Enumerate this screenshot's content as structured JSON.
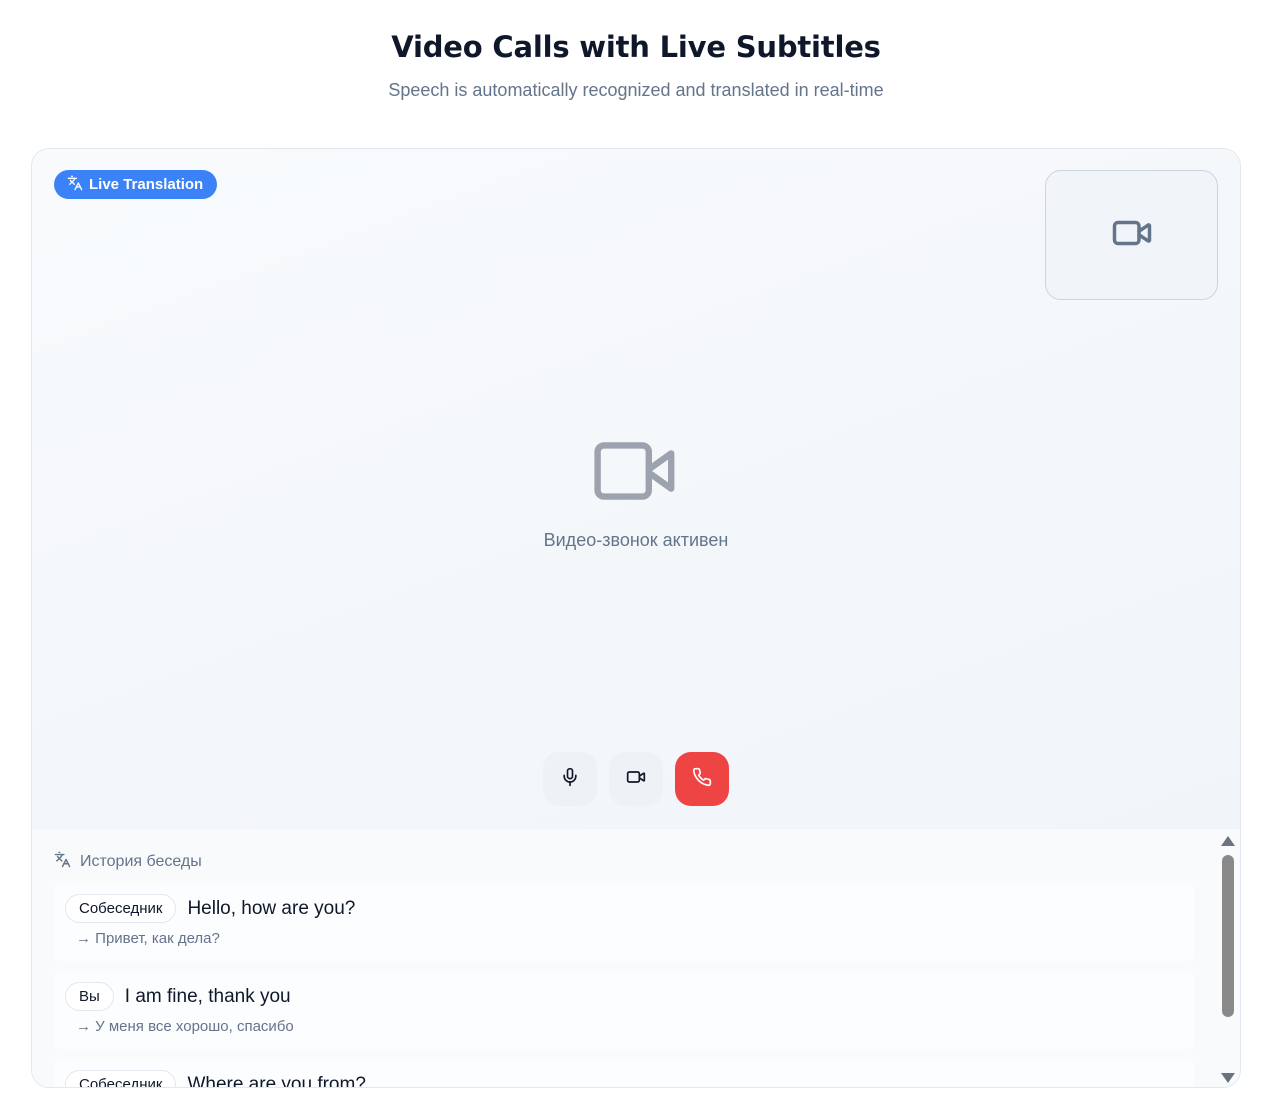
{
  "header": {
    "title": "Video Calls with Live Subtitles",
    "subtitle": "Speech is automatically recognized and translated in real-time"
  },
  "video": {
    "badge_label": "Live Translation",
    "badge_icon": "translate-icon",
    "self_view_icon": "video-camera-icon",
    "center_icon": "video-camera-icon",
    "status_text": "Видео-звонок активен"
  },
  "controls": [
    {
      "name": "microphone-button",
      "icon": "microphone-icon"
    },
    {
      "name": "camera-button",
      "icon": "video-camera-icon"
    },
    {
      "name": "end-call-button",
      "icon": "phone-icon",
      "color": "#ef4444"
    }
  ],
  "history": {
    "title": "История беседы",
    "icon": "translate-icon",
    "messages": [
      {
        "speaker": "Собеседник",
        "text": "Hello, how are you?",
        "translation": "→ Привет, как дела?"
      },
      {
        "speaker": "Вы",
        "text": "I am fine, thank you",
        "translation": "→ У меня все хорошо, спасибо"
      },
      {
        "speaker": "Собеседник",
        "text": "Where are you from?",
        "translation": ""
      }
    ]
  },
  "colors": {
    "accent": "#3b82f6",
    "danger": "#ef4444",
    "muted_text": "#64748b"
  }
}
